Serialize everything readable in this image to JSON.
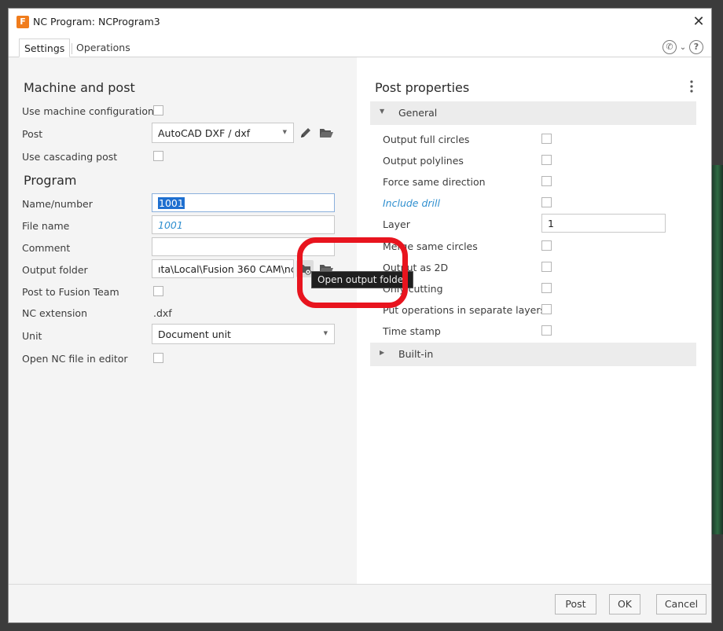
{
  "window": {
    "title": "NC Program: NCProgram3",
    "logo_letter": "F",
    "close_glyph": "✕"
  },
  "tabs": [
    {
      "label": "Settings",
      "active": true
    },
    {
      "label": "Operations",
      "active": false
    }
  ],
  "help": {
    "phone_glyph": "✆",
    "chevron_glyph": "⌄",
    "question_glyph": "?"
  },
  "left": {
    "machine_section": "Machine and post",
    "use_machine_configuration": {
      "label": "Use machine configuration",
      "checked": false
    },
    "post": {
      "label": "Post",
      "value": "AutoCAD DXF / dxf"
    },
    "use_cascading_post": {
      "label": "Use cascading post",
      "checked": false
    },
    "program_section": "Program",
    "name_number": {
      "label": "Name/number",
      "value": "1001"
    },
    "file_name": {
      "label": "File name",
      "value": "1001"
    },
    "comment": {
      "label": "Comment",
      "value": ""
    },
    "output_folder": {
      "label": "Output folder",
      "value": "ıta\\Local\\Fusion 360 CAM\\nc"
    },
    "post_to_fusion_team": {
      "label": "Post to Fusion Team",
      "checked": false
    },
    "nc_extension": {
      "label": "NC extension",
      "value": ".dxf"
    },
    "unit": {
      "label": "Unit",
      "value": "Document unit"
    },
    "open_nc_file": {
      "label": "Open NC file in editor",
      "checked": false
    }
  },
  "tooltip": "Open output folder",
  "right": {
    "title": "Post properties",
    "general_group": "General",
    "builtin_group": "Built-in",
    "properties": [
      {
        "label": "Output full circles",
        "type": "checkbox"
      },
      {
        "label": "Output polylines",
        "type": "checkbox"
      },
      {
        "label": "Force same direction",
        "type": "checkbox"
      },
      {
        "label": "Include drill",
        "type": "checkbox",
        "modified": true
      },
      {
        "label": "Layer",
        "type": "text",
        "value": "1"
      },
      {
        "label": "Merge same circles",
        "type": "checkbox"
      },
      {
        "label": "Output as 2D",
        "type": "checkbox"
      },
      {
        "label": "Only cutting",
        "type": "checkbox"
      },
      {
        "label": "Put operations in separate layers",
        "type": "checkbox"
      },
      {
        "label": "Time stamp",
        "type": "checkbox"
      }
    ]
  },
  "footer": {
    "post_button": "Post",
    "ok_button": "OK",
    "cancel_button": "Cancel"
  },
  "colors": {
    "accent": "#1e6fd0",
    "modified_label": "#2f8fcf",
    "highlight_ring": "#e8141e",
    "logo": "#f07c1c"
  }
}
